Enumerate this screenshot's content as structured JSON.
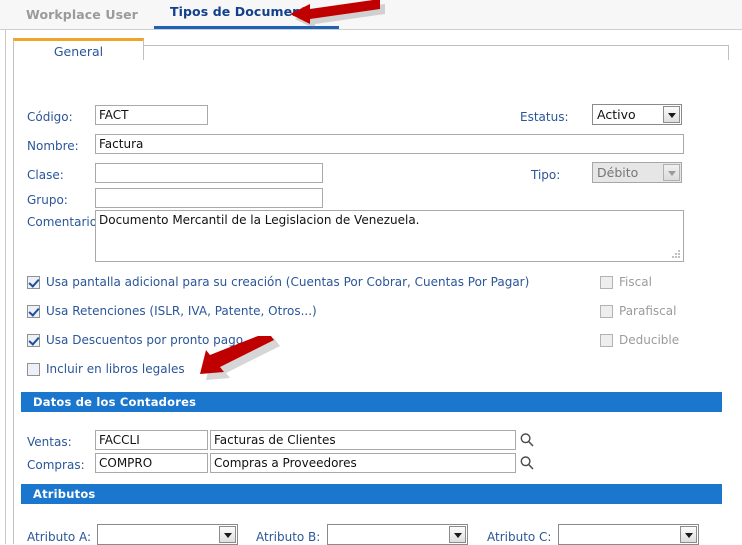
{
  "topbar": {
    "tabs": [
      {
        "label": "Workplace User",
        "active": false
      },
      {
        "label": "Tipos de Documentos",
        "active": true
      }
    ]
  },
  "panel": {
    "tab_label": "General"
  },
  "form": {
    "codigo_label": "Código:",
    "codigo_value": "FACT",
    "nombre_label": "Nombre:",
    "nombre_value": "Factura",
    "clase_label": "Clase:",
    "clase_value": "",
    "grupo_label": "Grupo:",
    "grupo_value": "",
    "comentario_label": "Comentario:",
    "comentario_value": "Documento Mercantil de la Legislacion de Venezuela.",
    "estatus_label": "Estatus:",
    "estatus_value": "Activo",
    "tipo_label": "Tipo:",
    "tipo_value": "Débito"
  },
  "checkboxes_left": [
    {
      "label": "Usa pantalla adicional para su creación (Cuentas Por Cobrar, Cuentas Por Pagar)",
      "checked": true,
      "disabled": false
    },
    {
      "label": "Usa Retenciones (ISLR, IVA, Patente, Otros...)",
      "checked": true,
      "disabled": false
    },
    {
      "label": "Usa Descuentos por pronto pago",
      "checked": true,
      "disabled": false
    },
    {
      "label": "Incluir en libros legales",
      "checked": false,
      "disabled": false
    }
  ],
  "checkboxes_right": [
    {
      "label": "Fiscal",
      "checked": false,
      "disabled": true
    },
    {
      "label": "Parafiscal",
      "checked": false,
      "disabled": true
    },
    {
      "label": "Deducible",
      "checked": false,
      "disabled": true
    }
  ],
  "contadores": {
    "section_title": "Datos de los Contadores",
    "ventas_label": "Ventas:",
    "ventas_code": "FACCLI",
    "ventas_desc": "Facturas de Clientes",
    "compras_label": "Compras:",
    "compras_code": "COMPRO",
    "compras_desc": "Compras a Proveedores",
    "search_icon": "magnifier-icon"
  },
  "atributos": {
    "section_title": "Atributos",
    "a_label": "Atributo A:",
    "a_value": "",
    "b_label": "Atributo B:",
    "b_value": "",
    "c_label": "Atributo C:",
    "c_value": ""
  },
  "annotations": [
    {
      "name": "arrow-pointing-to-tipos-de-documentos",
      "color": "#c00000"
    },
    {
      "name": "arrow-pointing-to-datos-de-los-contadores",
      "color": "#c00000"
    }
  ],
  "colors": {
    "section_blue": "#1b76ce",
    "label_blue": "#2a5699",
    "tab_active_blue": "#123f8c",
    "tab_underline": "#1f63b8",
    "panel_tab_orange": "#f0a429",
    "annotation_red": "#c00000"
  }
}
